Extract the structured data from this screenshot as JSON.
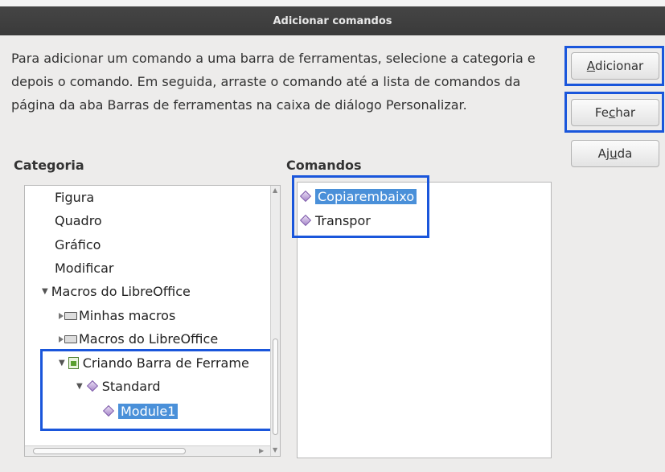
{
  "window": {
    "title": "Adicionar comandos"
  },
  "description": "Para adicionar um comando a uma barra de ferramentas, selecione a categoria e depois o comando. Em seguida, arraste o comando até a lista de comandos da página da aba Barras de ferramentas na caixa de diálogo Personalizar.",
  "buttons": {
    "add": {
      "pre": "",
      "mnemonic": "A",
      "post": "dicionar"
    },
    "close": {
      "pre": "Fe",
      "mnemonic": "c",
      "post": "har"
    },
    "help": {
      "pre": "Aj",
      "mnemonic": "u",
      "post": "da"
    }
  },
  "category": {
    "label": "Categoria",
    "items": [
      {
        "label": "Figura"
      },
      {
        "label": "Quadro"
      },
      {
        "label": "Gráfico"
      },
      {
        "label": "Modificar"
      },
      {
        "label": "Macros do LibreOffice",
        "expanded": true
      },
      {
        "label": "Minhas macros",
        "icon": "macro-library-icon"
      },
      {
        "label": "Macros do LibreOffice",
        "icon": "macro-library-icon"
      },
      {
        "label": "Criando Barra de Ferrame",
        "icon": "document-icon",
        "expanded": true
      },
      {
        "label": "Standard",
        "icon": "basic-library-icon",
        "expanded": true
      },
      {
        "label": "Module1",
        "icon": "module-icon",
        "selected": true
      }
    ]
  },
  "commands": {
    "label": "Comandos",
    "items": [
      {
        "label": "Copiarembaixo",
        "icon": "macro-icon",
        "selected": true
      },
      {
        "label": "Transpor",
        "icon": "macro-icon"
      }
    ]
  },
  "colors": {
    "highlight": "#1a56db",
    "selection": "#4a90d9",
    "titlebar": "#3c3c3c"
  }
}
